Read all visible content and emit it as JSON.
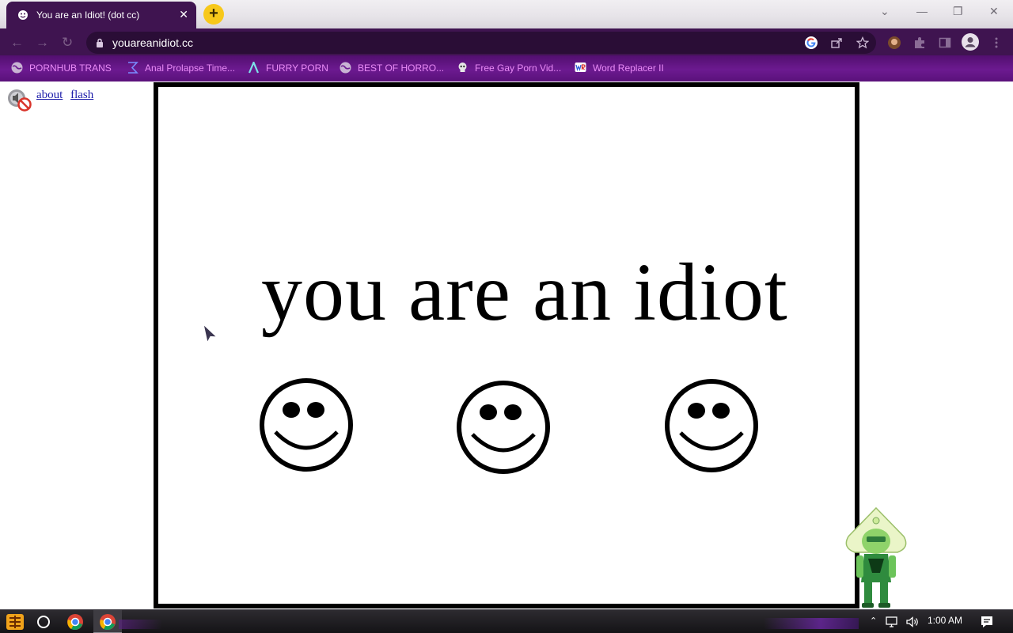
{
  "browser": {
    "tab_title": "You are an Idiot! (dot cc)",
    "tab_close": "✕",
    "new_tab": "+",
    "window_controls": {
      "dropdown": "⌄",
      "minimize": "—",
      "restore": "❐",
      "close": "✕"
    },
    "url": "youareanidiot.cc",
    "nav": {
      "back": "←",
      "forward": "→",
      "reload": "↻"
    },
    "accent_color": "#3f1450"
  },
  "bookmarks": [
    {
      "label": "PORNHUB TRANS",
      "icon": "globe-icon"
    },
    {
      "label": "Anal Prolapse Time...",
      "icon": "sigma-icon"
    },
    {
      "label": "FURRY PORN",
      "icon": "lambda-icon"
    },
    {
      "label": "BEST OF HORRO...",
      "icon": "globe-icon"
    },
    {
      "label": "Free Gay Porn Vid...",
      "icon": "skull-icon"
    },
    {
      "label": "Word Replacer II",
      "icon": "wr-icon"
    }
  ],
  "page": {
    "links": {
      "about": "about",
      "flash": "flash"
    },
    "headline": "you are an idiot",
    "smiley_count": 3
  },
  "taskbar": {
    "time": "1:00 AM",
    "tray_up": "⌃"
  }
}
